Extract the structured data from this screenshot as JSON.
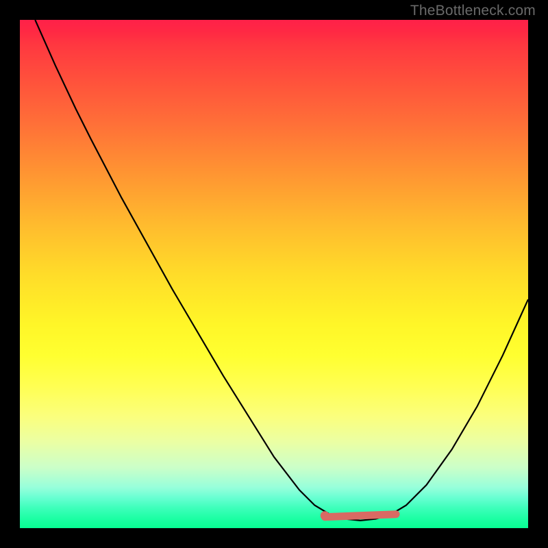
{
  "watermark": "TheBottleneck.com",
  "chart_data": {
    "type": "line",
    "title": "",
    "xlabel": "",
    "ylabel": "",
    "xlim": [
      0,
      100
    ],
    "ylim": [
      0,
      100
    ],
    "grid": false,
    "curve": [
      {
        "x": 3,
        "y": 100
      },
      {
        "x": 7,
        "y": 91
      },
      {
        "x": 11,
        "y": 82.5
      },
      {
        "x": 14,
        "y": 76.5
      },
      {
        "x": 20,
        "y": 65
      },
      {
        "x": 30,
        "y": 47
      },
      {
        "x": 40,
        "y": 30
      },
      {
        "x": 50,
        "y": 14
      },
      {
        "x": 55,
        "y": 7.5
      },
      {
        "x": 58,
        "y": 4.5
      },
      {
        "x": 61,
        "y": 2.7
      },
      {
        "x": 64,
        "y": 1.8
      },
      {
        "x": 67,
        "y": 1.5
      },
      {
        "x": 70,
        "y": 1.8
      },
      {
        "x": 73,
        "y": 2.7
      },
      {
        "x": 76,
        "y": 4.5
      },
      {
        "x": 80,
        "y": 8.5
      },
      {
        "x": 85,
        "y": 15.5
      },
      {
        "x": 90,
        "y": 24
      },
      {
        "x": 95,
        "y": 34
      },
      {
        "x": 100,
        "y": 45
      }
    ],
    "highlight_region": {
      "x_start": 60,
      "x_end": 74,
      "y": 2.2
    },
    "background_gradient": {
      "top_color": "#ff2149",
      "mid_color": "#fff630",
      "bottom_color": "#07ff93"
    }
  }
}
